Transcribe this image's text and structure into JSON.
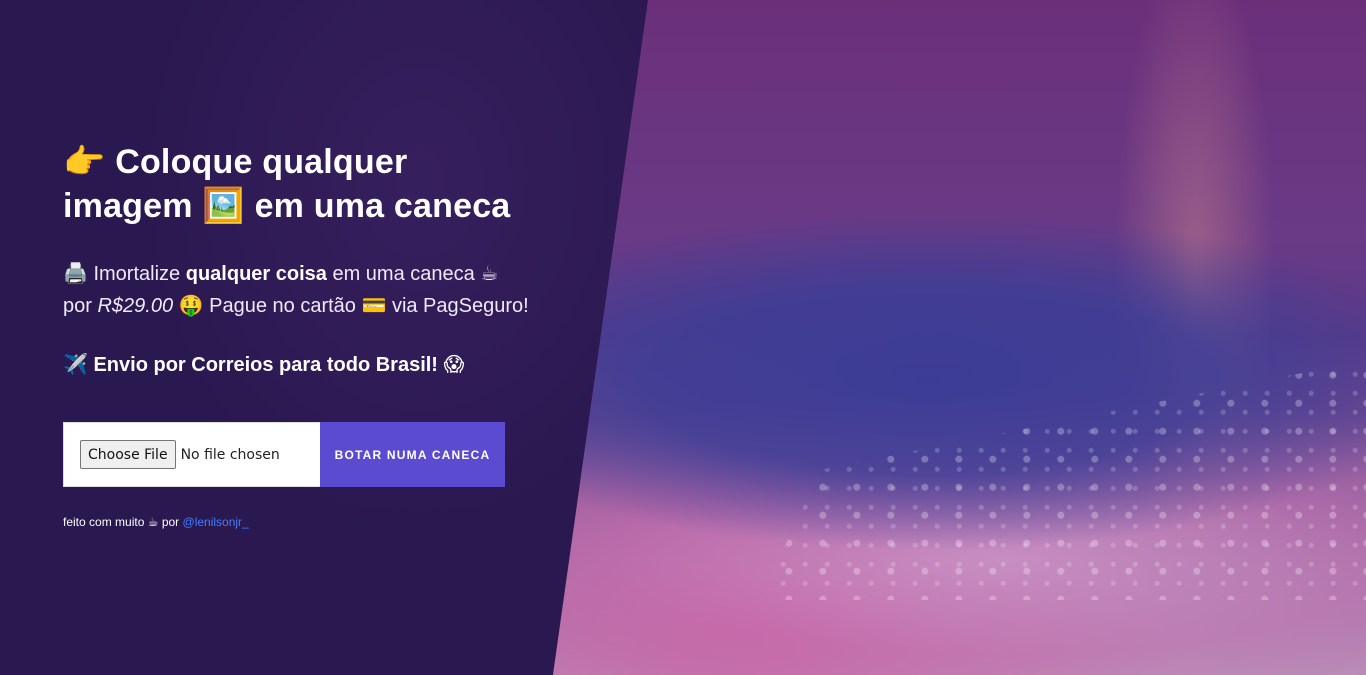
{
  "hero": {
    "title_line1_emoji": "👉",
    "title_line1": "Coloque qualquer",
    "title_line2_a": "imagem",
    "title_line2_emoji": "🖼️",
    "title_line2_b": "em uma caneca"
  },
  "subtitle": {
    "printer_emoji": "🖨️",
    "text_a": "Imortalize",
    "text_bold": "qualquer coisa",
    "text_b": "em uma caneca",
    "mug_emoji": "☕",
    "text_c": "por",
    "price": "R$29.00",
    "money_emoji": "🤑",
    "text_d": "Pague no cartão",
    "card_emoji": "💳",
    "text_e": "via PagSeguro!"
  },
  "shipping": {
    "plane_emoji": "✈️",
    "text": "Envio por Correios para todo Brasil!",
    "scream_emoji": "😱"
  },
  "form": {
    "choose_file_label": "Choose File",
    "no_file_text": "No file chosen",
    "submit_label": "BOTAR NUMA CANECA"
  },
  "footer": {
    "text_a": "feito com muito",
    "coffee_emoji": "☕",
    "text_b": "por",
    "author_link": "@lenilsonjr_"
  },
  "colors": {
    "background": "#2a1850",
    "submit_button": "#5a4bd1",
    "link": "#3f7cff"
  }
}
